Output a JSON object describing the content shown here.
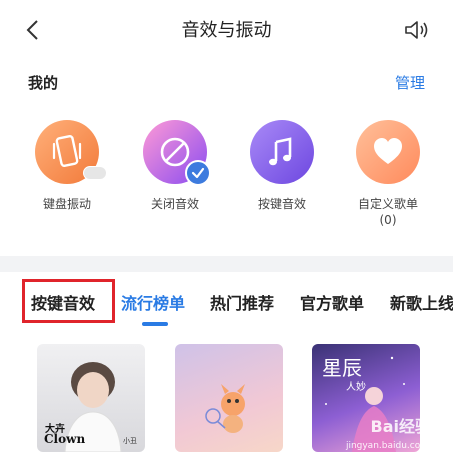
{
  "header": {
    "title": "音效与振动",
    "back_icon": "chevron-left-icon",
    "speaker_icon": "speaker-icon"
  },
  "mine": {
    "title": "我的",
    "manage_label": "管理",
    "items": [
      {
        "label": "键盘振动",
        "icon": "phone-vibrate-icon",
        "color": "#f27a3a"
      },
      {
        "label": "关闭音效",
        "icon": "mute-circle-icon",
        "color": "#8a4cf0",
        "selected": true
      },
      {
        "label": "按键音效",
        "icon": "music-note-icon",
        "color": "#6d47e0"
      },
      {
        "label": "自定义歌单",
        "count": "(0)",
        "icon": "heart-icon",
        "color": "#ff8a5c"
      }
    ]
  },
  "tabs": [
    {
      "label": "按键音效"
    },
    {
      "label": "流行榜单",
      "active": true
    },
    {
      "label": "热门推荐"
    },
    {
      "label": "官方歌单"
    },
    {
      "label": "新歌上线"
    }
  ],
  "thumbnails": [
    {
      "caption_top": "大卉",
      "caption_main": "Clown",
      "caption_small": "小丑"
    },
    {
      "name": "cartoon-fox-thumbnail"
    },
    {
      "caption_main": "星辰",
      "caption_sub": "人妙"
    }
  ],
  "watermark": {
    "main": "Bai经验",
    "sub": "jingyan.baidu.com"
  },
  "colors": {
    "accent": "#2a7be4",
    "highlight_box": "#e0242b"
  }
}
